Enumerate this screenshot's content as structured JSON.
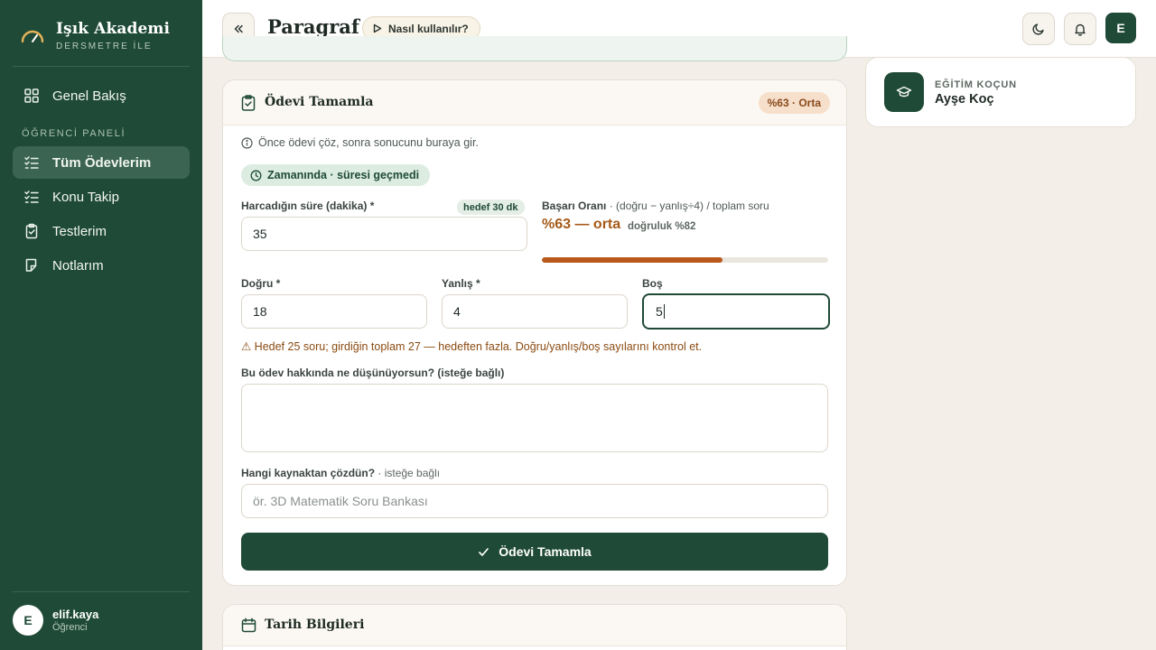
{
  "brand": {
    "name": "Işık Akademi",
    "subtitle": "DERSMETRE İLE"
  },
  "sidebar": {
    "overview": "Genel Bakış",
    "section_label": "ÖĞRENCİ PANELİ",
    "items": [
      {
        "label": "Tüm Ödevlerim",
        "icon": "checklist-icon",
        "active": true
      },
      {
        "label": "Konu Takip",
        "icon": "checklist-icon",
        "active": false
      },
      {
        "label": "Testlerim",
        "icon": "clipboard-icon",
        "active": false
      },
      {
        "label": "Notlarım",
        "icon": "note-icon",
        "active": false
      }
    ],
    "user": {
      "initial": "E",
      "name": "elif.kaya",
      "role": "Öğrenci"
    }
  },
  "header": {
    "title": "Paragraf",
    "howto_label": "Nasıl kullanılır?",
    "avatar_initial": "E"
  },
  "complete_card": {
    "title": "Ödevi Tamamla",
    "score_badge": "%63 · Orta",
    "info_text": "Önce ödevi çöz, sonra sonucunu buraya gir.",
    "status_pill": "Zamanında · süresi geçmedi",
    "duration": {
      "label": "Harcadığın süre (dakika) *",
      "target_chip": "hedef 30 dk",
      "value": "35"
    },
    "success": {
      "label_bold": "Başarı Oranı",
      "label_rest": " · (doğru − yanlış÷4) / toplam soru",
      "value": "%63 — orta",
      "accuracy": "doğruluk %82",
      "progress_percent": 63
    },
    "correct": {
      "label": "Doğru *",
      "value": "18"
    },
    "wrong": {
      "label": "Yanlış *",
      "value": "4"
    },
    "empty": {
      "label": "Boş",
      "value": "5"
    },
    "warning": "⚠ Hedef 25 soru; girdiğin toplam 27 — hedeften fazla. Doğru/yanlış/boş sayılarını kontrol et.",
    "comment": {
      "label": "Bu ödev hakkında ne düşünüyorsun? (isteğe bağlı)",
      "value": ""
    },
    "source": {
      "label": "Hangi kaynaktan çözdün?",
      "label_muted": " · isteğe bağlı",
      "placeholder": "ör. 3D Matematik Soru Bankası"
    },
    "submit_label": "Ödevi Tamamla"
  },
  "dates_card": {
    "title": "Tarih Bilgileri"
  },
  "coach": {
    "label": "EĞİTİM KOÇUN",
    "name": "Ayşe Koç"
  },
  "colors": {
    "primary": "#1f4a37",
    "accent": "#b8581b",
    "background": "#f3efe8"
  }
}
